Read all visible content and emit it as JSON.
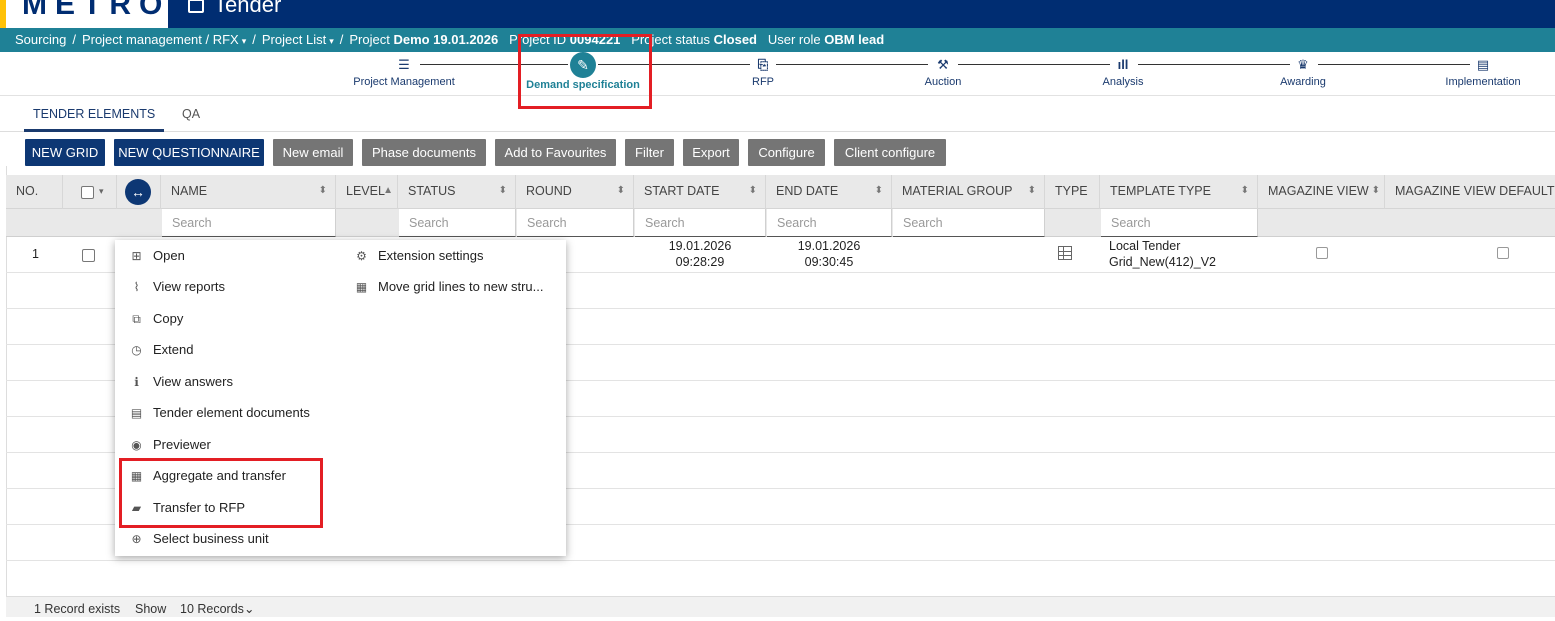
{
  "header": {
    "logo": "METRO",
    "app_title": "Tender"
  },
  "breadcrumb": {
    "sourcing": "Sourcing",
    "project_management": "Project management / RFX",
    "project_list": "Project List",
    "project_label": "Project",
    "project_name": "Demo 19.01.2026",
    "project_id_label": "Project ID",
    "project_id_value": "0094221",
    "status_label": "Project status",
    "status_value": "Closed",
    "role_label": "User role",
    "role_value": "OBM lead",
    "separator": "/",
    "caret": "▾"
  },
  "phases": [
    {
      "label": "Project Management",
      "icon": "list-icon",
      "glyph": "☰"
    },
    {
      "label": "Demand specification",
      "icon": "pencil-icon",
      "glyph": "✎"
    },
    {
      "label": "RFP",
      "icon": "document-check-icon",
      "glyph": "⎘"
    },
    {
      "label": "Auction",
      "icon": "gavel-icon",
      "glyph": "⚒"
    },
    {
      "label": "Analysis",
      "icon": "bar-chart-icon",
      "glyph": "ıll"
    },
    {
      "label": "Awarding",
      "icon": "award-icon",
      "glyph": "♛"
    },
    {
      "label": "Implementation",
      "icon": "implementation-icon",
      "glyph": "▤"
    }
  ],
  "tabs": [
    {
      "label": "TENDER ELEMENTS",
      "active": true
    },
    {
      "label": "QA",
      "active": false
    }
  ],
  "toolbar": {
    "new_grid": "NEW GRID",
    "new_questionnaire": "NEW QUESTIONNAIRE",
    "new_email": "New email",
    "phase_documents": "Phase documents",
    "add_to_favourites": "Add to Favourites",
    "filter": "Filter",
    "export": "Export",
    "configure": "Configure",
    "client_configure": "Client configure"
  },
  "columns": {
    "no": "NO.",
    "name": "NAME",
    "level": "LEVEL",
    "status": "STATUS",
    "round": "ROUND",
    "start_date": "START DATE",
    "end_date": "END DATE",
    "material_group": "MATERIAL GROUP",
    "type": "TYPE",
    "template_type": "TEMPLATE TYPE",
    "magazine_view": "MAGAZINE VIEW",
    "magazine_view_default": "MAGAZINE VIEW DEFAULT L",
    "sort_glyph": "⬍",
    "sort_up_glyph": "▲"
  },
  "search_placeholder": "Search",
  "rows": [
    {
      "no": "1",
      "start_date": "19.01.2026",
      "start_time": "09:28:29",
      "end_date": "19.01.2026",
      "end_time": "09:30:45",
      "template_type_line1": "Local Tender",
      "template_type_line2": "Grid_New(412)_V2",
      "type_icon": "grid-icon"
    }
  ],
  "context_menu": {
    "open": "Open",
    "view_reports": "View reports",
    "copy": "Copy",
    "extend": "Extend",
    "view_answers": "View answers",
    "tender_element_documents": "Tender element documents",
    "previewer": "Previewer",
    "aggregate_and_transfer": "Aggregate and transfer",
    "transfer_to_rfp": "Transfer to RFP",
    "select_business_unit": "Select business unit",
    "extension_settings": "Extension settings",
    "move_grid_lines": "Move grid lines to new stru..."
  },
  "footer": {
    "records_exist": "1 Record exists",
    "show_label": "Show",
    "records_option": "10 Records",
    "caret": "⌄"
  },
  "colors": {
    "primary": "#0d3774",
    "teal": "#1f8196",
    "highlight": "#e31e24",
    "grey_button": "#757575"
  }
}
